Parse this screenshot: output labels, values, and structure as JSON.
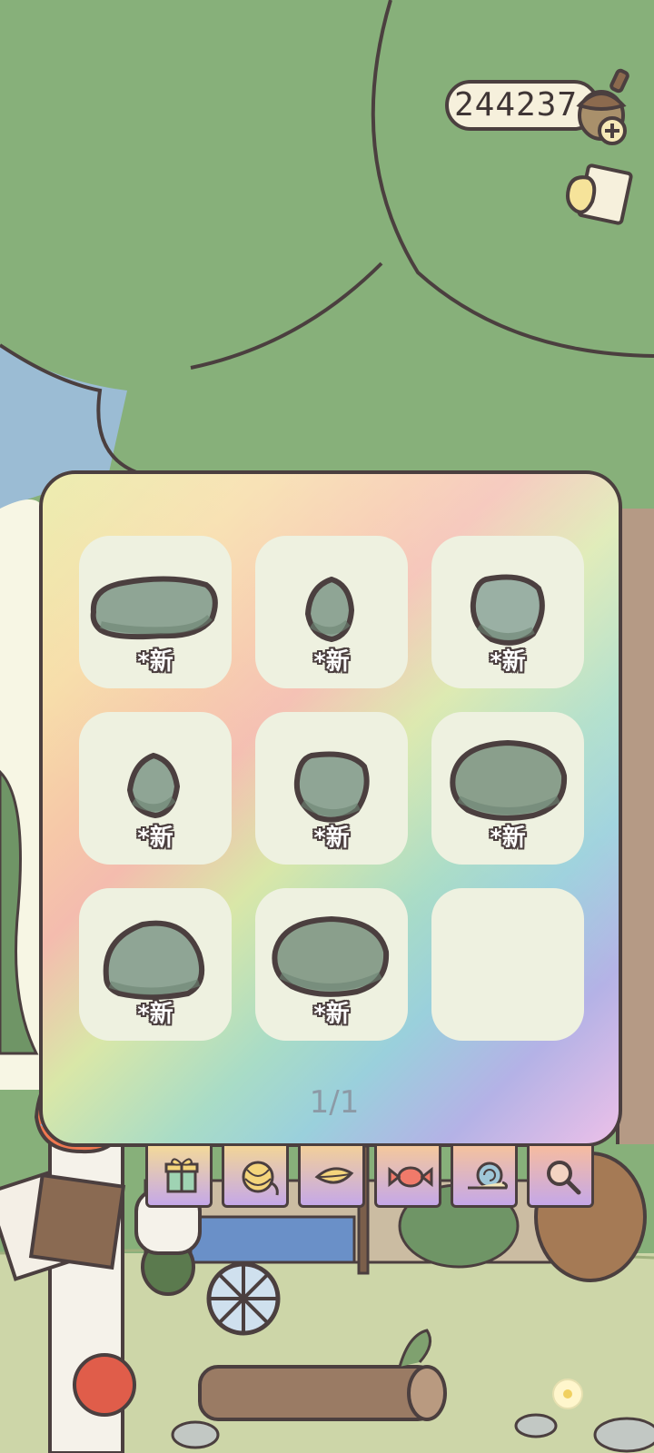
{
  "currency": {
    "amount": "244237",
    "icon": "acorn-icon"
  },
  "mail": {
    "icon": "mail-icon"
  },
  "panel": {
    "page_indicator": "1/1",
    "items": [
      {
        "label": "*新",
        "icon": "stone-flat-icon"
      },
      {
        "label": "*新",
        "icon": "stone-small-icon"
      },
      {
        "label": "*新",
        "icon": "stone-round-icon"
      },
      {
        "label": "*新",
        "icon": "stone-small-icon"
      },
      {
        "label": "*新",
        "icon": "stone-round-icon"
      },
      {
        "label": "*新",
        "icon": "stone-large-icon"
      },
      {
        "label": "*新",
        "icon": "stone-round-icon"
      },
      {
        "label": "*新",
        "icon": "stone-large-icon"
      }
    ]
  },
  "tabs": [
    {
      "icon": "gift-icon"
    },
    {
      "icon": "yarn-icon"
    },
    {
      "icon": "leaf-icon"
    },
    {
      "icon": "candy-icon"
    },
    {
      "icon": "snail-icon"
    },
    {
      "icon": "magnifier-icon"
    }
  ],
  "colors": {
    "outline": "#4b3f3f",
    "stone": "#8fa595",
    "slot": "#eef1e0",
    "tree": "#87b07a"
  }
}
